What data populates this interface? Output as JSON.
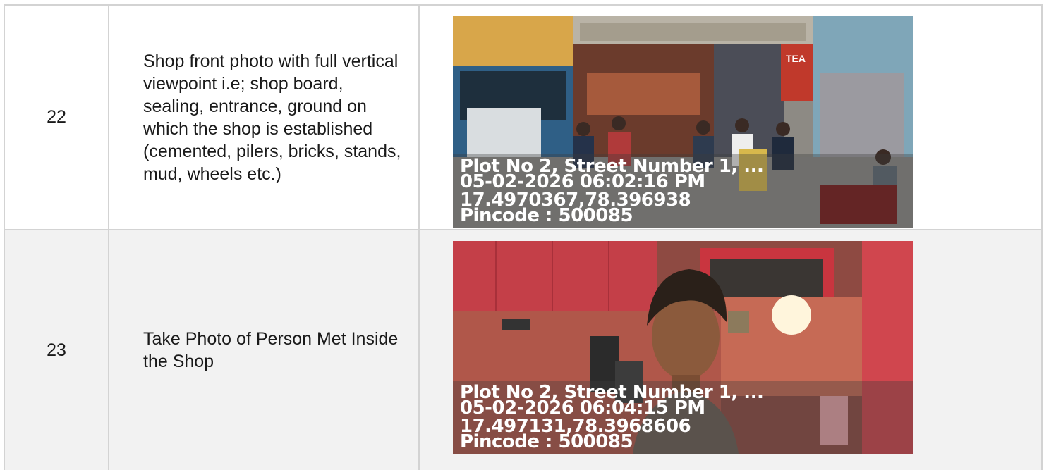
{
  "rows": [
    {
      "number": "22",
      "description": "Shop front photo with full vertical viewpoint i.e; shop board, sealing, entrance, ground on which the shop is established (cemented, pilers, bricks, stands, mud, wheels etc.)",
      "photo": {
        "scene": "shop-front-photo",
        "stamp": {
          "address": "Plot No 2, Street Number 1, ...",
          "datetime": "05-02-2026 06:02:16 PM",
          "coordinates": "17.4970367,78.396938",
          "pincode": "Pincode : 500085"
        },
        "sign_text": "TEA"
      }
    },
    {
      "number": "23",
      "description": "Take Photo of Person Met Inside the Shop",
      "photo": {
        "scene": "person-inside-shop-photo",
        "stamp": {
          "address": "Plot No 2, Street Number 1, ...",
          "datetime": "05-02-2026 06:04:15 PM",
          "coordinates": "17.497131,78.3968606",
          "pincode": "Pincode : 500085"
        }
      }
    }
  ]
}
